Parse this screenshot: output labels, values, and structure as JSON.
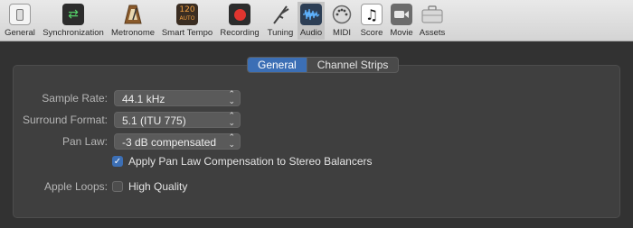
{
  "toolbar": {
    "items": [
      {
        "label": "General",
        "icon": "general-switch-icon"
      },
      {
        "label": "Synchronization",
        "icon": "sync-icon"
      },
      {
        "label": "Metronome",
        "icon": "metronome-icon"
      },
      {
        "label": "Smart Tempo",
        "icon": "smart-tempo-icon",
        "badge_top": "120",
        "badge_bottom": "AUTO"
      },
      {
        "label": "Recording",
        "icon": "record-icon"
      },
      {
        "label": "Tuning",
        "icon": "tuning-fork-icon"
      },
      {
        "label": "Audio",
        "icon": "audio-waveform-icon",
        "selected": true
      },
      {
        "label": "MIDI",
        "icon": "midi-icon"
      },
      {
        "label": "Score",
        "icon": "music-note-icon"
      },
      {
        "label": "Movie",
        "icon": "camera-icon"
      },
      {
        "label": "Assets",
        "icon": "assets-case-icon"
      }
    ]
  },
  "tabs": [
    {
      "label": "General",
      "active": true
    },
    {
      "label": "Channel Strips",
      "active": false
    }
  ],
  "settings": {
    "sample_rate": {
      "label": "Sample Rate:",
      "value": "44.1 kHz"
    },
    "surround_format": {
      "label": "Surround Format:",
      "value": "5.1 (ITU 775)"
    },
    "pan_law": {
      "label": "Pan Law:",
      "value": "-3 dB compensated"
    },
    "apply_pan_law": {
      "label": "Apply Pan Law Compensation to Stereo Balancers",
      "checked": true
    },
    "apple_loops": {
      "label": "Apple Loops:",
      "option": "High Quality",
      "checked": false
    }
  },
  "colors": {
    "accent": "#3c6fb5",
    "panel": "#3f3f3f",
    "background": "#323232"
  }
}
